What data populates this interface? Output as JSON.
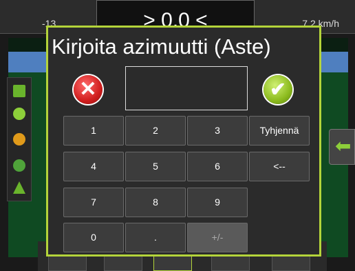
{
  "status_bar": {
    "left_value": "-13",
    "center_value": "> 0.0 <",
    "right_value": "7.2 km/h"
  },
  "dialog": {
    "title": "Kirjoita azimuutti (Aste)",
    "input_value": "",
    "keys": {
      "k1": "1",
      "k2": "2",
      "k3": "3",
      "clear": "Tyhjennä",
      "k4": "4",
      "k5": "5",
      "k6": "6",
      "backspace": "<--",
      "k7": "7",
      "k8": "8",
      "k9": "9",
      "k0": "0",
      "dot": ".",
      "plusminus": "+/-"
    },
    "cancel_icon": "x-icon",
    "ok_icon": "check-icon"
  },
  "side_icons": [
    "boundary-icon",
    "guidance-line-icon",
    "marker-icon",
    "steering-icon",
    "vehicle-icon"
  ],
  "right_arrow_icon": "arrow-left-icon",
  "colors": {
    "dialog_border": "#b4d43a",
    "cancel": "#d11e1e",
    "ok": "#8cbb1e",
    "arrow": "#8dcf3a"
  }
}
